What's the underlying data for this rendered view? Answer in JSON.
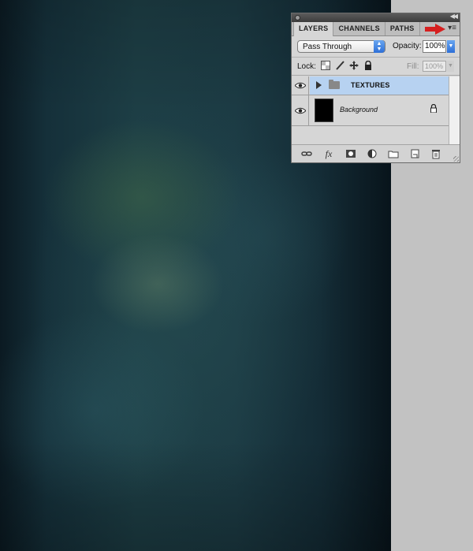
{
  "panel": {
    "tabs": [
      "LAYERS",
      "CHANNELS",
      "PATHS"
    ],
    "blend_mode": "Pass Through",
    "opacity_label": "Opacity:",
    "opacity_value": "100%",
    "lock_label": "Lock:",
    "fill_label": "Fill:",
    "fill_value": "100%",
    "layers": [
      {
        "name": "TEXTURES",
        "type": "group",
        "visible": true,
        "selected": true
      },
      {
        "name": "Background",
        "type": "layer",
        "visible": true,
        "locked": true
      }
    ],
    "bottom_icons": [
      "link-icon",
      "fx-icon",
      "mask-icon",
      "adjustment-icon",
      "folder-icon",
      "new-layer-icon",
      "trash-icon"
    ]
  },
  "colors": {
    "selected_row": "#b7d2f1",
    "annotation_arrow": "#d61f1f",
    "workspace": "#c2c2c2"
  }
}
